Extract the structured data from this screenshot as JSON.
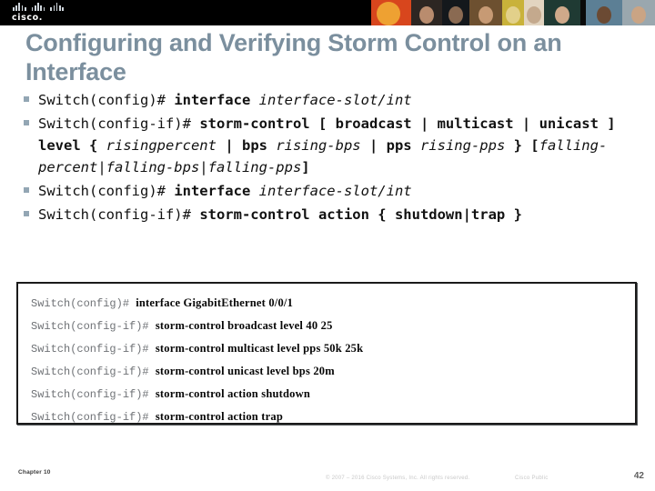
{
  "header": {
    "logo": {
      "name": "cisco-logo",
      "wordmark": "cisco.",
      "bar_color": "#cfd6dc"
    },
    "background_color": "#000000",
    "photo_tiles": [
      {
        "name": "abstract-orange",
        "bg": "#d8461d",
        "accent": "#f5c03a"
      },
      {
        "name": "portrait-woman-dark-hair",
        "bg": "#2d2622",
        "accent": "#b98c6e"
      },
      {
        "name": "portrait-man-suit",
        "bg": "#14181c",
        "accent": "#8a6a52"
      },
      {
        "name": "portrait-woman-center",
        "bg": "#6d5030",
        "accent": "#c79a74"
      },
      {
        "name": "portrait-scarf-yellow",
        "bg": "#c9b23a",
        "accent": "#e2d08a"
      },
      {
        "name": "portrait-light-veil",
        "bg": "#e2d4c0",
        "accent": "#c4a98d"
      },
      {
        "name": "portrait-woman-green-bg",
        "bg": "#1f3a33",
        "accent": "#cfa98a"
      },
      {
        "name": "divider-dark",
        "bg": "#0a0a0a",
        "accent": "#0a0a0a"
      },
      {
        "name": "portrait-man-blue-bg",
        "bg": "#5c7f95",
        "accent": "#6b4a33"
      },
      {
        "name": "portrait-man-cap",
        "bg": "#9aa7ae",
        "accent": "#caa484"
      }
    ]
  },
  "title": {
    "text": "Configuring and Verifying Storm Control on an Interface",
    "color": "#7b8f9e"
  },
  "bullets": [
    {
      "name": "bullet-interface-command",
      "segments": [
        {
          "text": "Switch(config)# ",
          "style": "normal"
        },
        {
          "text": "interface ",
          "style": "bold"
        },
        {
          "text": "interface-slot/int",
          "style": "italic"
        }
      ]
    },
    {
      "name": "bullet-storm-control-level-command",
      "segments": [
        {
          "text": "Switch(config-if)# ",
          "style": "normal"
        },
        {
          "text": "storm-control [ broadcast | multicast | unicast ] level { ",
          "style": "bold"
        },
        {
          "text": "risingpercent",
          "style": "italic"
        },
        {
          "text": " | ",
          "style": "bold"
        },
        {
          "text": "bps ",
          "style": "bold"
        },
        {
          "text": "rising-bps",
          "style": "italic"
        },
        {
          "text": " | ",
          "style": "bold"
        },
        {
          "text": "pps ",
          "style": "bold"
        },
        {
          "text": "rising-pps",
          "style": "italic"
        },
        {
          "text": " } [",
          "style": "bold"
        },
        {
          "text": "falling-percent|falling-bps|falling-pps",
          "style": "italic"
        },
        {
          "text": "]",
          "style": "bold"
        }
      ]
    },
    {
      "name": "bullet-interface-command-2",
      "segments": [
        {
          "text": "Switch(config)# ",
          "style": "normal"
        },
        {
          "text": "interface ",
          "style": "bold"
        },
        {
          "text": "interface-slot/int",
          "style": "italic"
        }
      ]
    },
    {
      "name": "bullet-storm-control-action-command",
      "segments": [
        {
          "text": "Switch(config-if)# ",
          "style": "normal"
        },
        {
          "text": "storm-control action { shutdown|trap }",
          "style": "bold"
        }
      ]
    }
  ],
  "code_box": {
    "name": "cli-output-box",
    "lines": [
      {
        "prompt": "Switch(config)# ",
        "command": "interface GigabitEthernet 0/0/1"
      },
      {
        "prompt": "Switch(config-if)# ",
        "command": "storm-control broadcast level 40 25"
      },
      {
        "prompt": "Switch(config-if)# ",
        "command": "storm-control multicast level pps 50k 25k"
      },
      {
        "prompt": "Switch(config-if)# ",
        "command": "storm-control unicast level bps 20m"
      },
      {
        "prompt": "Switch(config-if)# ",
        "command": "storm-control action shutdown"
      },
      {
        "prompt": "Switch(config-if)# ",
        "command": "storm-control action trap"
      }
    ]
  },
  "footer": {
    "chapter": "Chapter 10",
    "copyright": "© 2007 – 2016  Cisco Systems, Inc. All rights reserved.",
    "confidentiality": "Cisco Public",
    "page_number": "42"
  }
}
